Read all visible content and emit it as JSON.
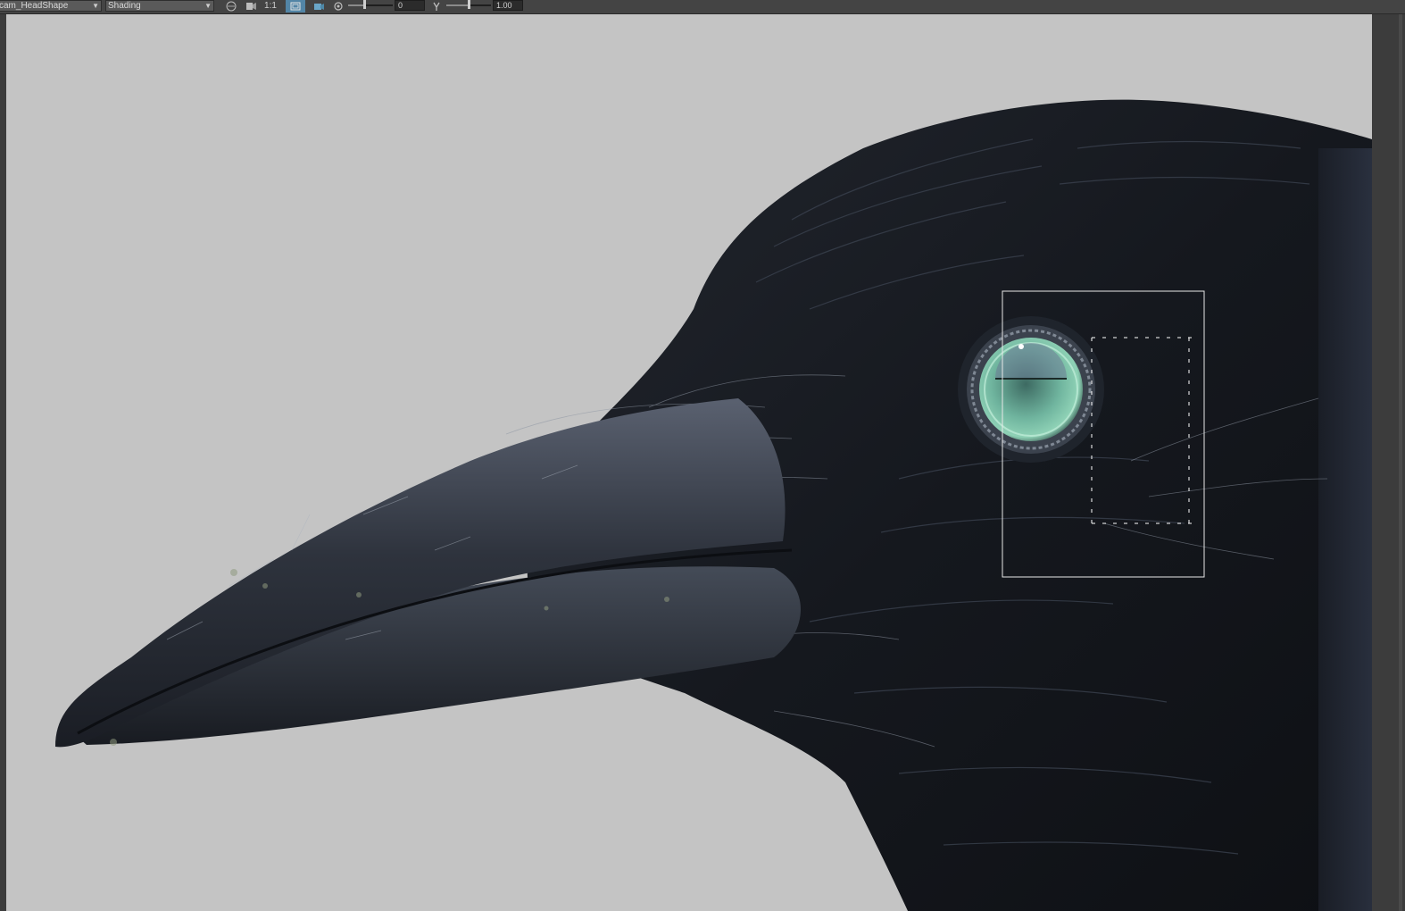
{
  "toolbar": {
    "camera_select": "cam_HeadShape",
    "shading_select": "Shading",
    "grid_icon": "grid-icon",
    "resolution_gate_icon": "camera-shading-icon",
    "one_to_one_label": "1:1",
    "film_gate_icon": "film-gate-icon",
    "isolate_icon": "isolate-select-icon",
    "exposure_icon": "exposure-icon",
    "exposure_value": "0",
    "exposure_level": 0.35,
    "gamma_icon": "gamma-icon",
    "gamma_value": "1.00",
    "gamma_level": 0.5,
    "active_color": "#5285a6"
  },
  "viewport": {
    "background_color": "#c4c4c4",
    "subject": "raven head render",
    "selection_box": "eye-selection-box"
  }
}
